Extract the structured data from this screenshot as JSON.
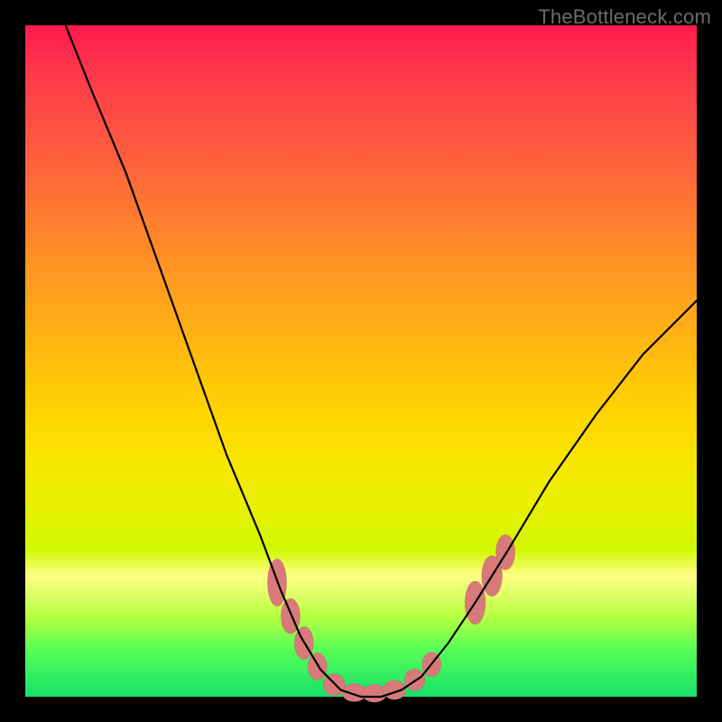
{
  "watermark": "TheBottleneck.com",
  "colors": {
    "frame": "#000000",
    "curve": "#000000",
    "clusterFill": "#d97a7a",
    "clusterStroke": "#c96868",
    "gradientStops": [
      {
        "offset": 0,
        "hex": "#ff1a4d"
      },
      {
        "offset": 8,
        "hex": "#ff3b4a"
      },
      {
        "offset": 18,
        "hex": "#ff5a40"
      },
      {
        "offset": 28,
        "hex": "#ff7a30"
      },
      {
        "offset": 38,
        "hex": "#ff9a20"
      },
      {
        "offset": 48,
        "hex": "#ffb810"
      },
      {
        "offset": 58,
        "hex": "#ffd500"
      },
      {
        "offset": 66,
        "hex": "#f5e800"
      },
      {
        "offset": 72,
        "hex": "#e8f000"
      },
      {
        "offset": 78,
        "hex": "#d0f800"
      },
      {
        "offset": 82,
        "hex": "#fdff86"
      },
      {
        "offset": 88,
        "hex": "#b8ff40"
      },
      {
        "offset": 93,
        "hex": "#57ff57"
      },
      {
        "offset": 100,
        "hex": "#16e06a"
      }
    ]
  },
  "chart_data": {
    "type": "line",
    "title": "",
    "xlabel": "",
    "ylabel": "",
    "xlim": [
      0,
      100
    ],
    "ylim": [
      0,
      100
    ],
    "curve": [
      {
        "x": 6,
        "y": 100
      },
      {
        "x": 10,
        "y": 90
      },
      {
        "x": 15,
        "y": 78
      },
      {
        "x": 20,
        "y": 64
      },
      {
        "x": 25,
        "y": 50
      },
      {
        "x": 30,
        "y": 36
      },
      {
        "x": 35,
        "y": 24
      },
      {
        "x": 38,
        "y": 16
      },
      {
        "x": 41,
        "y": 9
      },
      {
        "x": 44,
        "y": 4
      },
      {
        "x": 47,
        "y": 1
      },
      {
        "x": 50,
        "y": 0
      },
      {
        "x": 53,
        "y": 0
      },
      {
        "x": 56,
        "y": 1
      },
      {
        "x": 59,
        "y": 3
      },
      {
        "x": 63,
        "y": 8
      },
      {
        "x": 67,
        "y": 14
      },
      {
        "x": 72,
        "y": 22
      },
      {
        "x": 78,
        "y": 32
      },
      {
        "x": 85,
        "y": 42
      },
      {
        "x": 92,
        "y": 51
      },
      {
        "x": 100,
        "y": 59
      }
    ],
    "clusters": [
      {
        "x": 37.5,
        "y": 17,
        "rx": 1.4,
        "ry": 3.5
      },
      {
        "x": 39.5,
        "y": 12,
        "rx": 1.4,
        "ry": 2.6
      },
      {
        "x": 41.5,
        "y": 8,
        "rx": 1.4,
        "ry": 2.4
      },
      {
        "x": 43.5,
        "y": 4.5,
        "rx": 1.4,
        "ry": 2.0
      },
      {
        "x": 46.0,
        "y": 1.8,
        "rx": 1.6,
        "ry": 1.6
      },
      {
        "x": 49.0,
        "y": 0.6,
        "rx": 1.8,
        "ry": 1.3
      },
      {
        "x": 52.0,
        "y": 0.5,
        "rx": 1.8,
        "ry": 1.3
      },
      {
        "x": 55.0,
        "y": 1.0,
        "rx": 1.7,
        "ry": 1.4
      },
      {
        "x": 58.0,
        "y": 2.5,
        "rx": 1.5,
        "ry": 1.6
      },
      {
        "x": 60.5,
        "y": 4.8,
        "rx": 1.4,
        "ry": 1.8
      },
      {
        "x": 67.0,
        "y": 14,
        "rx": 1.5,
        "ry": 3.2
      },
      {
        "x": 69.5,
        "y": 18,
        "rx": 1.5,
        "ry": 3.0
      },
      {
        "x": 71.5,
        "y": 21.5,
        "rx": 1.4,
        "ry": 2.6
      }
    ]
  }
}
